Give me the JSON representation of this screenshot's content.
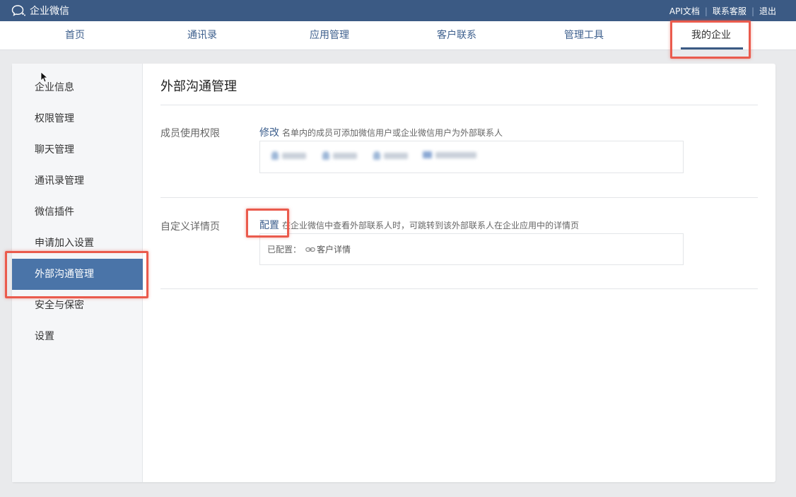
{
  "app": {
    "title": "企业微信"
  },
  "top_links": [
    "API文档",
    "联系客服",
    "退出"
  ],
  "nav": {
    "items": [
      {
        "label": "首页"
      },
      {
        "label": "通讯录"
      },
      {
        "label": "应用管理"
      },
      {
        "label": "客户联系"
      },
      {
        "label": "管理工具"
      },
      {
        "label": "我的企业"
      }
    ],
    "active": "我的企业"
  },
  "sidebar": {
    "items": [
      {
        "label": "企业信息"
      },
      {
        "label": "权限管理"
      },
      {
        "label": "聊天管理"
      },
      {
        "label": "通讯录管理"
      },
      {
        "label": "微信插件"
      },
      {
        "label": "申请加入设置"
      },
      {
        "label": "外部沟通管理"
      },
      {
        "label": "安全与保密"
      },
      {
        "label": "设置"
      }
    ],
    "active": "外部沟通管理"
  },
  "main": {
    "title": "外部沟通管理",
    "member_permission": {
      "label": "成员使用权限",
      "action": "修改",
      "description": "名单内的成员可添加微信用户或企业微信用户为外部联系人"
    },
    "custom_detail": {
      "label": "自定义详情页",
      "action": "配置",
      "description": "在企业微信中查看外部联系人时，可跳转到该外部联系人在企业应用中的详情页",
      "configured_label": "已配置：",
      "configured_value": "客户详情"
    }
  },
  "colors": {
    "topbar": "#3b5a84",
    "accent": "#4a74a8",
    "link": "#3d5f8d",
    "highlight": "#ea5b4d"
  }
}
